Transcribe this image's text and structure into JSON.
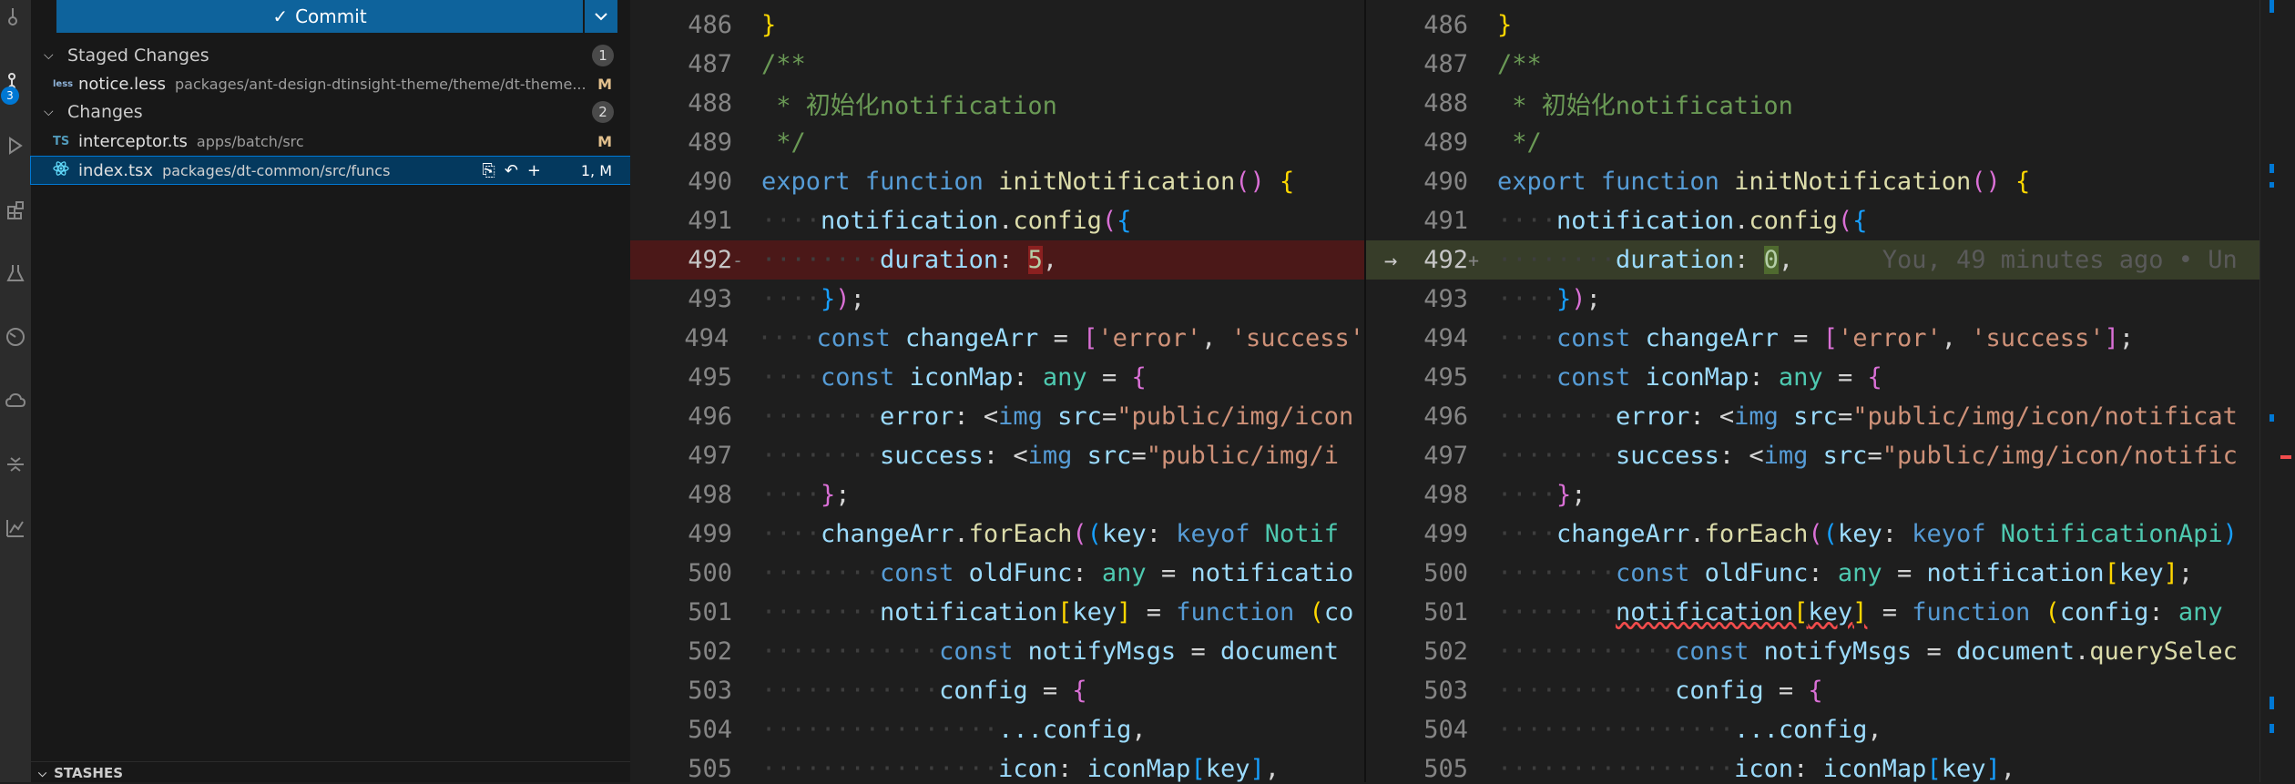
{
  "scm": {
    "badge_count": "3",
    "commit_label": "Commit",
    "staged": {
      "title": "Staged Changes",
      "count": "1"
    },
    "changes": {
      "title": "Changes",
      "count": "2"
    },
    "files": [
      {
        "icon": "less",
        "name": "notice.less",
        "path": "packages/ant-design-dtinsight-theme/theme/dt-theme...",
        "status": "M"
      },
      {
        "icon": "TS",
        "name": "interceptor.ts",
        "path": "apps/batch/src",
        "status": "M"
      },
      {
        "icon": "react",
        "name": "index.tsx",
        "path": "packages/dt-common/src/funcs",
        "status": "1, M"
      }
    ],
    "stashes": "STASHES"
  },
  "diff": {
    "blame": "You, 49 minutes ago • Un",
    "line_numbers": [
      "486",
      "487",
      "488",
      "489",
      "490",
      "491",
      "492",
      "493",
      "494",
      "495",
      "496",
      "497",
      "498",
      "499",
      "500",
      "501",
      "502",
      "503",
      "504",
      "505"
    ],
    "markers": {
      "left": "-",
      "right": "+",
      "arrow": "→"
    },
    "code": {
      "l486": "}",
      "l487": "/**",
      "l488": " * 初始化notification",
      "l489": " */",
      "export": "export",
      "function": "function",
      "initNotification": "initNotification",
      "notification": "notification",
      "config": "config",
      "duration": "duration",
      "old_value": "5",
      "new_value": "0",
      "const": "const",
      "changeArr": "changeArr",
      "iconMap": "iconMap",
      "any": "any",
      "error_str": "'error'",
      "success_str": "'success'",
      "error": "error",
      "success": "success",
      "img": "img",
      "src": "src",
      "src_left_err": "\"public/img/icon",
      "src_left_succ": "\"public/img/i",
      "src_right_err": "\"public/img/icon/notificat",
      "src_right_succ": "\"public/img/icon/notific",
      "forEach": "forEach",
      "key": "key",
      "keyof": "keyof",
      "notif_left": "Notif",
      "notif_right": "NotificationApi",
      "oldFunc": "oldFunc",
      "notificatio": "notificatio",
      "co": "co",
      "notifyMsgs": "notifyMsgs",
      "document": "document",
      "querySelec": "querySelec",
      "spread_config": "...config",
      "icon": "icon"
    }
  }
}
